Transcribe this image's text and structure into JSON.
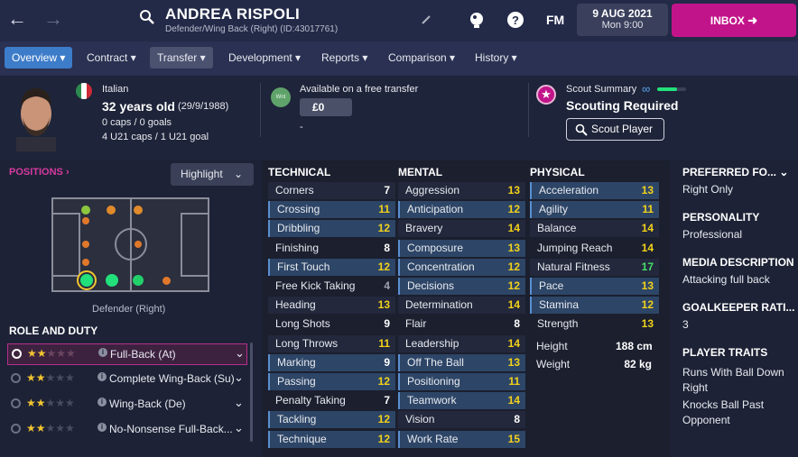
{
  "header": {
    "player_name": "ANDREA RISPOLI",
    "player_sub": "Defender/Wing Back (Right) (ID:43017761)",
    "fm_label": "FM",
    "date": "9 AUG 2021",
    "time": "Mon 9:00",
    "inbox_label": "INBOX"
  },
  "tabs": [
    {
      "label": "Overview"
    },
    {
      "label": "Contract"
    },
    {
      "label": "Transfer"
    },
    {
      "label": "Development"
    },
    {
      "label": "Reports"
    },
    {
      "label": "Comparison"
    },
    {
      "label": "History"
    }
  ],
  "profile": {
    "nationality": "Italian",
    "age": "32 years old",
    "dob": "(29/9/1988)",
    "caps": "0 caps / 0 goals",
    "u21": "4 U21 caps / 1 U21 goal",
    "transfer_status": "Available on a free transfer",
    "wnt_badge": "Wnt",
    "fee": "£0",
    "fee_sub": "-",
    "scout_summary_label": "Scout Summary",
    "scouting_status": "Scouting Required",
    "scout_button": "Scout Player"
  },
  "positions": {
    "title": "POSITIONS",
    "highlight": "Highlight",
    "position_label": "Defender (Right)"
  },
  "roles": {
    "title": "ROLE AND DUTY",
    "items": [
      {
        "label": "Full-Back (At)",
        "stars": 2
      },
      {
        "label": "Complete Wing-Back (Su)",
        "stars": 2
      },
      {
        "label": "Wing-Back (De)",
        "stars": 2
      },
      {
        "label": "No-Nonsense Full-Back...",
        "stars": 2
      }
    ]
  },
  "technical": {
    "title": "TECHNICAL",
    "items": [
      {
        "label": "Corners",
        "value": "7"
      },
      {
        "label": "Crossing",
        "value": "11"
      },
      {
        "label": "Dribbling",
        "value": "12"
      },
      {
        "label": "Finishing",
        "value": "8"
      },
      {
        "label": "First Touch",
        "value": "12"
      },
      {
        "label": "Free Kick Taking",
        "value": "4"
      },
      {
        "label": "Heading",
        "value": "13"
      },
      {
        "label": "Long Shots",
        "value": "9"
      },
      {
        "label": "Long Throws",
        "value": "11"
      },
      {
        "label": "Marking",
        "value": "9"
      },
      {
        "label": "Passing",
        "value": "12"
      },
      {
        "label": "Penalty Taking",
        "value": "7"
      },
      {
        "label": "Tackling",
        "value": "12"
      },
      {
        "label": "Technique",
        "value": "12"
      }
    ]
  },
  "mental": {
    "title": "MENTAL",
    "items": [
      {
        "label": "Aggression",
        "value": "13"
      },
      {
        "label": "Anticipation",
        "value": "12"
      },
      {
        "label": "Bravery",
        "value": "14"
      },
      {
        "label": "Composure",
        "value": "13"
      },
      {
        "label": "Concentration",
        "value": "12"
      },
      {
        "label": "Decisions",
        "value": "12"
      },
      {
        "label": "Determination",
        "value": "14"
      },
      {
        "label": "Flair",
        "value": "8"
      },
      {
        "label": "Leadership",
        "value": "14"
      },
      {
        "label": "Off The Ball",
        "value": "13"
      },
      {
        "label": "Positioning",
        "value": "11"
      },
      {
        "label": "Teamwork",
        "value": "14"
      },
      {
        "label": "Vision",
        "value": "8"
      },
      {
        "label": "Work Rate",
        "value": "15"
      }
    ]
  },
  "physical": {
    "title": "PHYSICAL",
    "items": [
      {
        "label": "Acceleration",
        "value": "13"
      },
      {
        "label": "Agility",
        "value": "11"
      },
      {
        "label": "Balance",
        "value": "14"
      },
      {
        "label": "Jumping Reach",
        "value": "14"
      },
      {
        "label": "Natural Fitness",
        "value": "17"
      },
      {
        "label": "Pace",
        "value": "13"
      },
      {
        "label": "Stamina",
        "value": "12"
      },
      {
        "label": "Strength",
        "value": "13"
      }
    ],
    "height_label": "Height",
    "height": "188 cm",
    "weight_label": "Weight",
    "weight": "82 kg"
  },
  "side": {
    "preferred_foot_title": "PREFERRED FO...",
    "preferred_foot": "Right Only",
    "personality_title": "PERSONALITY",
    "personality": "Professional",
    "media_title": "MEDIA DESCRIPTION",
    "media": "Attacking full back",
    "gk_title": "GOALKEEPER RATI...",
    "gk": "3",
    "traits_title": "PLAYER TRAITS",
    "trait1_a": "Runs With Ball Down",
    "trait1_b": "Right",
    "trait2_a": "Knocks Ball Past",
    "trait2_b": "Opponent"
  },
  "colors": {
    "accent": "#c2148a",
    "tab_active": "#3d7cc9",
    "value_yellow": "#f2d21b",
    "value_green": "#45e06a",
    "value_grey": "#9fa3b0",
    "value_white": "#ffffff"
  }
}
